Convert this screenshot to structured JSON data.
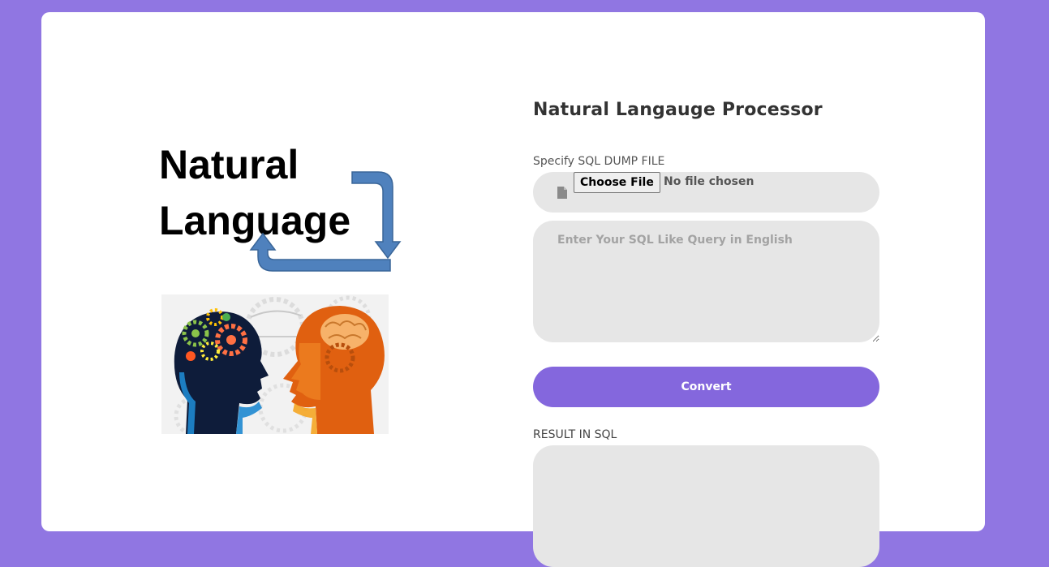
{
  "hero": {
    "line1": "Natural",
    "line2": "Language"
  },
  "form": {
    "title": "Natural Langauge Processor",
    "dump_label": "Specify SQL DUMP FILE",
    "choose_file_label": "Choose File",
    "no_file_text": "No file chosen",
    "query_placeholder": "Enter Your SQL Like Query in English",
    "query_value": "",
    "convert_label": "Convert",
    "result_label": "RESULT IN SQL",
    "result_value": ""
  },
  "icons": {
    "file": "file-icon",
    "cycle_arrow": "cycle-arrow-icon"
  },
  "colors": {
    "background": "#9076e2",
    "accent": "#8467dd",
    "field": "#e6e6e6",
    "arrow": "#4f81bd"
  }
}
